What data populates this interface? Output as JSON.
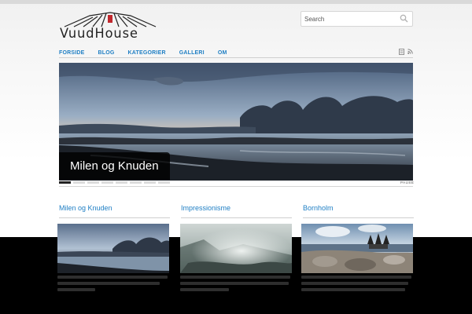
{
  "logo": {
    "text": "VuudHouse",
    "icon": "house-roof-logo"
  },
  "search": {
    "placeholder": "Search",
    "icon": "search-icon"
  },
  "nav": {
    "items": [
      {
        "label": "FORSIDE"
      },
      {
        "label": "BLOG"
      },
      {
        "label": "KATEGORIER"
      },
      {
        "label": "GALLERI"
      },
      {
        "label": "OM"
      }
    ],
    "icons": [
      "page-icon",
      "rss-icon"
    ]
  },
  "slider": {
    "caption": "Milen og Knuden",
    "pause_label": "PAUSE",
    "slide_count": 8,
    "active_slide": 1
  },
  "posts": [
    {
      "title": "Milen og Knuden"
    },
    {
      "title": "Impressionisme"
    },
    {
      "title": "Bornholm"
    }
  ],
  "colors": {
    "accent": "#1f7fc4",
    "footer_background": "#000000",
    "caption_background": "#000000"
  }
}
